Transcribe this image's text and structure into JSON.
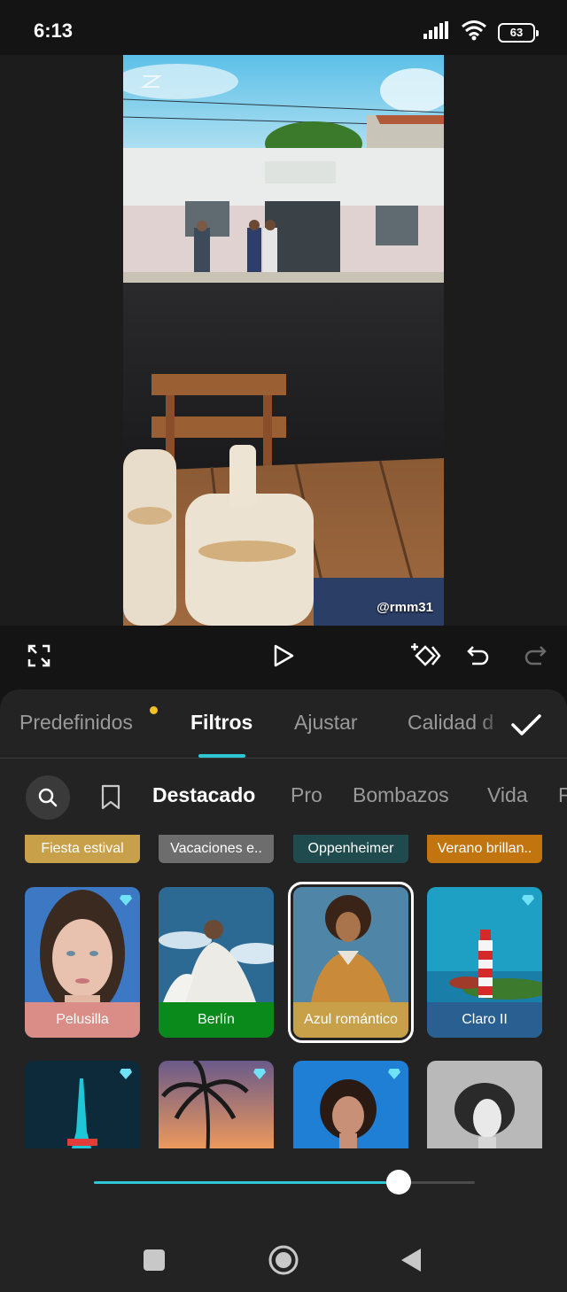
{
  "status_bar": {
    "time": "6:13",
    "battery": "63",
    "icons": [
      "signal-icon",
      "wifi-icon",
      "battery-icon"
    ]
  },
  "preview": {
    "watermark": "@rmm31"
  },
  "controls": {
    "icons": [
      "fullscreen-icon",
      "play-icon",
      "keyframe-icon",
      "undo-icon",
      "redo-icon"
    ]
  },
  "main_tabs": [
    {
      "label": "Predefinidos",
      "has_new_dot": true
    },
    {
      "label": "Filtros",
      "active": true
    },
    {
      "label": "Ajustar"
    },
    {
      "label": "Calidad d"
    }
  ],
  "categories": [
    {
      "label": "Destacado",
      "active": true
    },
    {
      "label": "Pro"
    },
    {
      "label": "Bombazos"
    },
    {
      "label": "Vida"
    },
    {
      "label": "F"
    }
  ],
  "chips": [
    {
      "label": "Fiesta estival",
      "color": "#c9a04a"
    },
    {
      "label": "Vacaciones e..",
      "color": "#6d6d6d"
    },
    {
      "label": "Oppenheimer",
      "color": "#1f4a4e"
    },
    {
      "label": "Verano brillan..",
      "color": "#c2740f"
    }
  ],
  "filters_row1": [
    {
      "label": "Pelusilla",
      "color": "#d98d86",
      "pro": true
    },
    {
      "label": "Berlín",
      "color": "#0b8a1c",
      "pro": false
    },
    {
      "label": "Azul romántico",
      "color": "#c9a04a",
      "pro": false,
      "selected": true
    },
    {
      "label": "Claro II",
      "color": "#2a5f91",
      "pro": true
    }
  ],
  "filters_row2": [
    {
      "pro": true
    },
    {
      "pro": true
    },
    {
      "pro": true
    },
    {
      "pro": false
    }
  ],
  "slider": {
    "value_fraction": 0.8
  },
  "colors": {
    "accent": "#2fc6d4",
    "new_dot": "#f5c023",
    "pro_diamond": "#6fe3f5"
  }
}
